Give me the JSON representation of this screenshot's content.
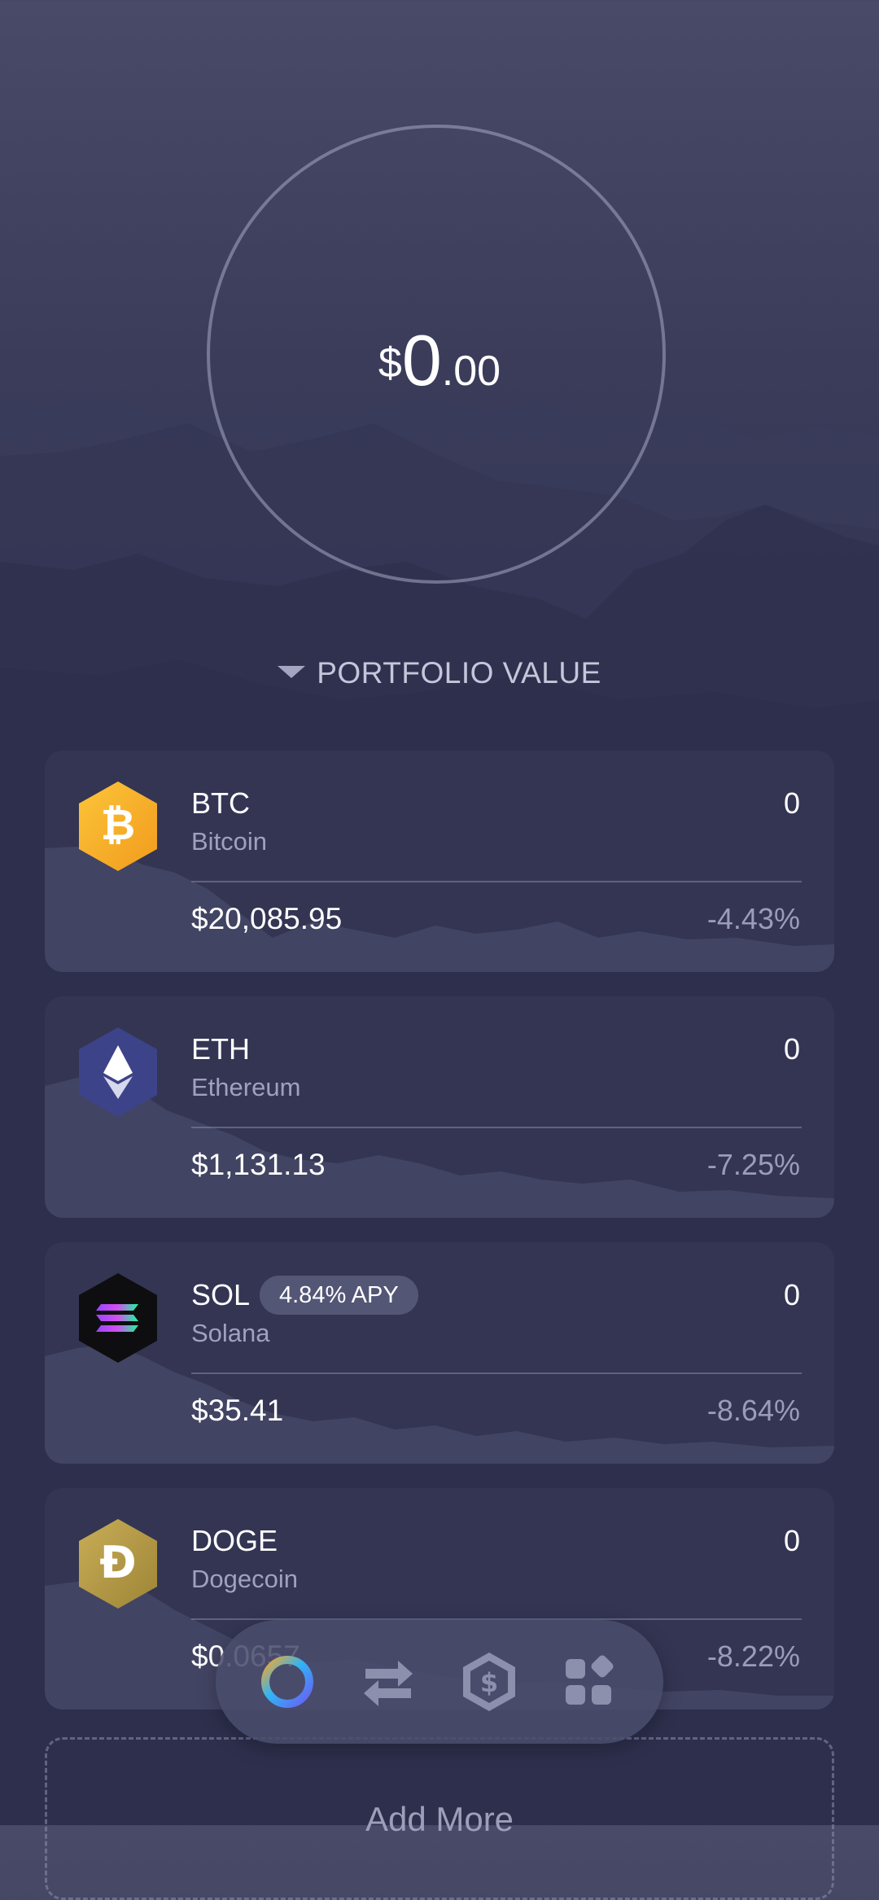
{
  "portfolio": {
    "currency_symbol": "$",
    "integer": "0",
    "decimal": ".00",
    "label": "PORTFOLIO VALUE"
  },
  "assets": [
    {
      "ticker": "BTC",
      "name": "Bitcoin",
      "holding": "0",
      "price": "$20,085.95",
      "change": "-4.43%",
      "icon": "bitcoin-icon",
      "color": "#f7b229"
    },
    {
      "ticker": "ETH",
      "name": "Ethereum",
      "holding": "0",
      "price": "$1,131.13",
      "change": "-7.25%",
      "icon": "ethereum-icon",
      "color": "#3d4388"
    },
    {
      "ticker": "SOL",
      "name": "Solana",
      "holding": "0",
      "price": "$35.41",
      "change": "-8.64%",
      "icon": "solana-icon",
      "color": "#111111",
      "badge": "4.84% APY"
    },
    {
      "ticker": "DOGE",
      "name": "Dogecoin",
      "holding": "0",
      "price": "$0.0657",
      "change": "-8.22%",
      "icon": "dogecoin-icon",
      "color": "#b59a45"
    }
  ],
  "add_more": {
    "label": "Add More"
  },
  "nav": {
    "items": [
      {
        "icon": "portfolio-ring-icon"
      },
      {
        "icon": "exchange-arrows-icon"
      },
      {
        "icon": "dollar-hexagon-icon"
      },
      {
        "icon": "apps-grid-icon"
      }
    ]
  },
  "colors": {
    "background": "#2f3150",
    "accent_ring_start": "#f7a72a",
    "accent_ring_end": "#6b5cf5"
  }
}
